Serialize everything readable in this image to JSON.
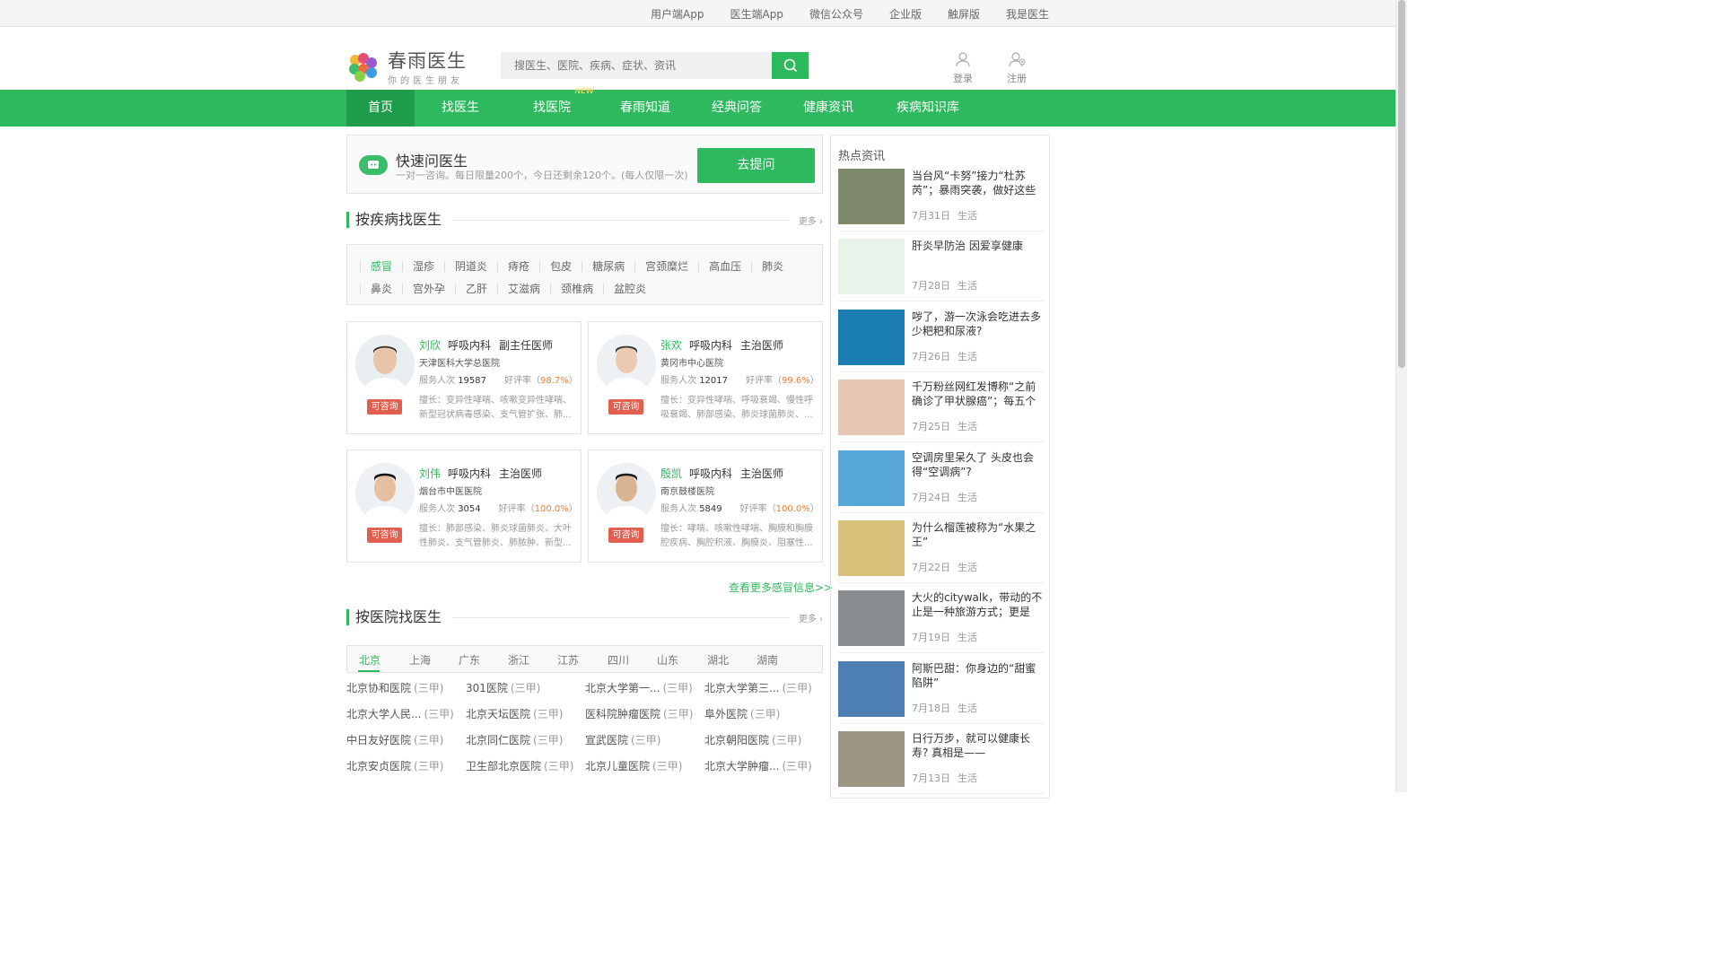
{
  "topbar": {
    "links": [
      "用户端App",
      "医生端App",
      "微信公众号",
      "企业版",
      "触屏版",
      "我是医生"
    ]
  },
  "header": {
    "logo_title": "春雨医生",
    "logo_sub": "你的医生朋友",
    "search_placeholder": "搜医生、医院、疾病、症状、资讯",
    "login": "登录",
    "register": "注册"
  },
  "nav": {
    "items": [
      "首页",
      "找医生",
      "找医院",
      "春雨知道",
      "经典问答",
      "健康资讯",
      "疾病知识库"
    ],
    "new_badge": "NEW"
  },
  "quick_ask": {
    "title": "快速问医生",
    "desc": "一对一咨询。每日限量200个，今日还剩余120个。(每人仅限一次)",
    "button": "去提问"
  },
  "by_disease": {
    "title": "按疾病找医生",
    "more": "更多",
    "row1": [
      "感冒",
      "湿疹",
      "阴道炎",
      "痔疮",
      "包皮",
      "糖尿病",
      "宫颈糜烂",
      "高血压",
      "肺炎"
    ],
    "row2": [
      "鼻炎",
      "宫外孕",
      "乙肝",
      "艾滋病",
      "颈椎病",
      "盆腔炎"
    ]
  },
  "doctors": [
    {
      "name": "刘欣",
      "dept": "呼吸内科",
      "title": "副主任医师",
      "hospital": "天津医科大学总医院",
      "service_label": "服务人次",
      "service": "19587",
      "rate_label": "好评率（",
      "rate": "98.7%",
      "rate_end": "）",
      "consult": "可咨询",
      "desc": "擅长：变异性哮喘、咳嗽变异性哮喘、新型冠状病毒感染、支气管扩张、肺..."
    },
    {
      "name": "张欢",
      "dept": "呼吸内科",
      "title": "主治医师",
      "hospital": "黄冈市中心医院",
      "service_label": "服务人次",
      "service": "12017",
      "rate_label": "好评率（",
      "rate": "99.6%",
      "rate_end": "）",
      "consult": "可咨询",
      "desc": "擅长：变异性哮喘、呼吸衰竭、慢性呼吸衰竭、肺部感染、肺炎球菌肺炎、..."
    },
    {
      "name": "刘伟",
      "dept": "呼吸内科",
      "title": "主治医师",
      "hospital": "烟台市中医医院",
      "service_label": "服务人次",
      "service": "3054",
      "rate_label": "好评率（",
      "rate": "100.0%",
      "rate_end": "）",
      "consult": "可咨询",
      "desc": "擅长：肺部感染、肺炎球菌肺炎、大叶性肺炎、支气管肺炎、肺脓肿、新型..."
    },
    {
      "name": "殷凯",
      "dept": "呼吸内科",
      "title": "主治医师",
      "hospital": "南京鼓楼医院",
      "service_label": "服务人次",
      "service": "5849",
      "rate_label": "好评率（",
      "rate": "100.0%",
      "rate_end": "）",
      "consult": "可咨询",
      "desc": "擅长：哮喘、咳嗽性哮喘、胸膜和胸膜腔疾病、胸腔积液、胸膜炎、阻塞性..."
    }
  ],
  "more_cold": "查看更多感冒信息>>",
  "by_hospital": {
    "title": "按医院找医生",
    "more": "更多",
    "provinces": [
      "北京",
      "上海",
      "广东",
      "浙江",
      "江苏",
      "四川",
      "山东",
      "湖北",
      "湖南"
    ],
    "hospitals": [
      {
        "name": "北京协和医院",
        "level": "(三甲)"
      },
      {
        "name": "301医院",
        "level": "(三甲)"
      },
      {
        "name": "北京大学第一...",
        "level": "(三甲)"
      },
      {
        "name": "北京大学第三...",
        "level": "(三甲)"
      },
      {
        "name": "北京大学人民...",
        "level": "(三甲)"
      },
      {
        "name": "北京天坛医院",
        "level": "(三甲)"
      },
      {
        "name": "医科院肿瘤医院",
        "level": "(三甲)"
      },
      {
        "name": "阜外医院",
        "level": "(三甲)"
      },
      {
        "name": "中日友好医院",
        "level": "(三甲)"
      },
      {
        "name": "北京同仁医院",
        "level": "(三甲)"
      },
      {
        "name": "宣武医院",
        "level": "(三甲)"
      },
      {
        "name": "北京朝阳医院",
        "level": "(三甲)"
      },
      {
        "name": "北京安贞医院",
        "level": "(三甲)"
      },
      {
        "name": "卫生部北京医院",
        "level": "(三甲)"
      },
      {
        "name": "北京儿童医院",
        "level": "(三甲)"
      },
      {
        "name": "北京大学肿瘤...",
        "level": "(三甲)"
      }
    ]
  },
  "news": {
    "title": "热点资讯",
    "items": [
      {
        "text": "当台风“卡努”接力“杜苏芮”；暴雨突袭，做好这些才安全",
        "date": "7月31日",
        "cat": "生活",
        "color": "#7f8a6d"
      },
      {
        "text": "肝炎早防治 因爱享健康",
        "date": "7月28日",
        "cat": "生活",
        "color": "#e9f3ea"
      },
      {
        "text": "哕了，游一次泳会吃进去多少粑粑和尿液?",
        "date": "7月26日",
        "cat": "生活",
        "color": "#1a7fb0"
      },
      {
        "text": "千万粉丝网红发博称“之前确诊了甲状腺癌”；每五个成人...",
        "date": "7月25日",
        "cat": "生活",
        "color": "#e6c7b4"
      },
      {
        "text": "空调房里呆久了 头皮也会得“空调病”?",
        "date": "7月24日",
        "cat": "生活",
        "color": "#57a7d8"
      },
      {
        "text": "为什么榴莲被称为“水果之王”",
        "date": "7月22日",
        "cat": "生活",
        "color": "#d9c07a"
      },
      {
        "text": "大火的citywalk，带动的不止是一种旅游方式；更是一...",
        "date": "7月19日",
        "cat": "生活",
        "color": "#8a8d90"
      },
      {
        "text": "阿斯巴甜：你身边的“甜蜜陷阱”",
        "date": "7月18日",
        "cat": "生活",
        "color": "#4d7fb5"
      },
      {
        "text": "日行万步，就可以健康长寿? 真相是——",
        "date": "7月13日",
        "cat": "生活",
        "color": "#9c9685"
      }
    ]
  }
}
